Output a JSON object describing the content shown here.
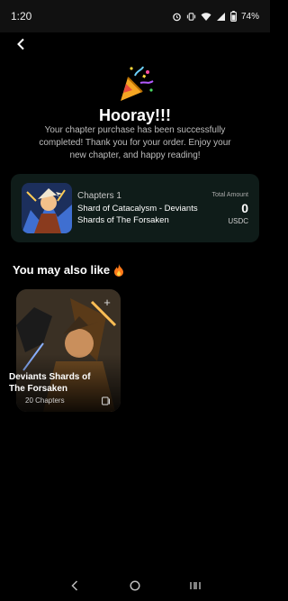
{
  "status_bar": {
    "time": "1:20",
    "battery": "74%",
    "icons": [
      "alarm-icon",
      "vibrate-icon",
      "wifi-icon",
      "signal-icon",
      "battery-icon"
    ]
  },
  "header": {
    "back_icon": "chevron-left-icon"
  },
  "success": {
    "icon": "party-popper-icon",
    "title": "Hooray!!!",
    "message": "Your chapter purchase has been successfully completed! Thank you for your order. Enjoy your new chapter, and happy reading!"
  },
  "order": {
    "chapter": "Chapters 1",
    "name": "Shard of Catacalysm - Deviants Shards of The Forsaken",
    "amount_label": "Total Amount",
    "amount": "0",
    "currency": "USDC"
  },
  "recommendations": {
    "title": "You may also like",
    "title_icon": "fire-icon",
    "items": [
      {
        "title": "Deviants Shards of The Forsaken",
        "chapters": "20 Chapters",
        "add_icon": "plus-icon",
        "list_icon": "chapter-list-icon"
      }
    ]
  },
  "colors": {
    "background": "#000000",
    "card_background": "#0f1c19",
    "text_muted": "#bdbdbd"
  }
}
